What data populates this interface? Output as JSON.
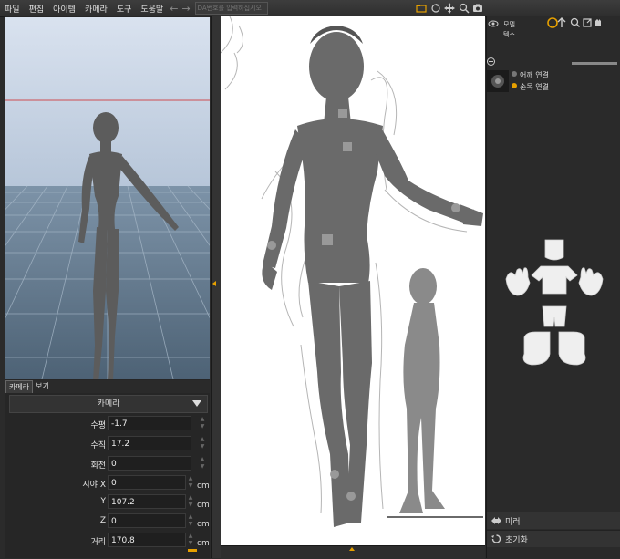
{
  "menu": [
    "파일",
    "편집",
    "아이템",
    "카메라",
    "도구",
    "도움말"
  ],
  "toolbar": {
    "da_placeholder": "DA번호를 입력하십시오"
  },
  "left_tabs": [
    "카메라",
    "보기"
  ],
  "camera_dropdown": "카메라",
  "camera_props": [
    {
      "label": "수평",
      "value": "-1.7",
      "unit": ""
    },
    {
      "label": "수직",
      "value": "17.2",
      "unit": ""
    },
    {
      "label": "회전",
      "value": "0",
      "unit": ""
    },
    {
      "label": "시야 X",
      "value": "0",
      "unit": "cm"
    },
    {
      "label": "Y",
      "value": "107.2",
      "unit": "cm"
    },
    {
      "label": "Z",
      "value": "0",
      "unit": "cm"
    },
    {
      "label": "거리",
      "value": "170.8",
      "unit": "cm"
    }
  ],
  "layers": {
    "model": "모델",
    "text": "텍스"
  },
  "connections": {
    "shoulder": "어깨 연결",
    "wrist": "손목 연결"
  },
  "side_buttons": {
    "mirror": "미러",
    "reset": "초기화"
  },
  "colors": {
    "accent": "#e6a000",
    "viewport_sky": "#c9d6e8",
    "grid_floor": "#6a7f93"
  }
}
